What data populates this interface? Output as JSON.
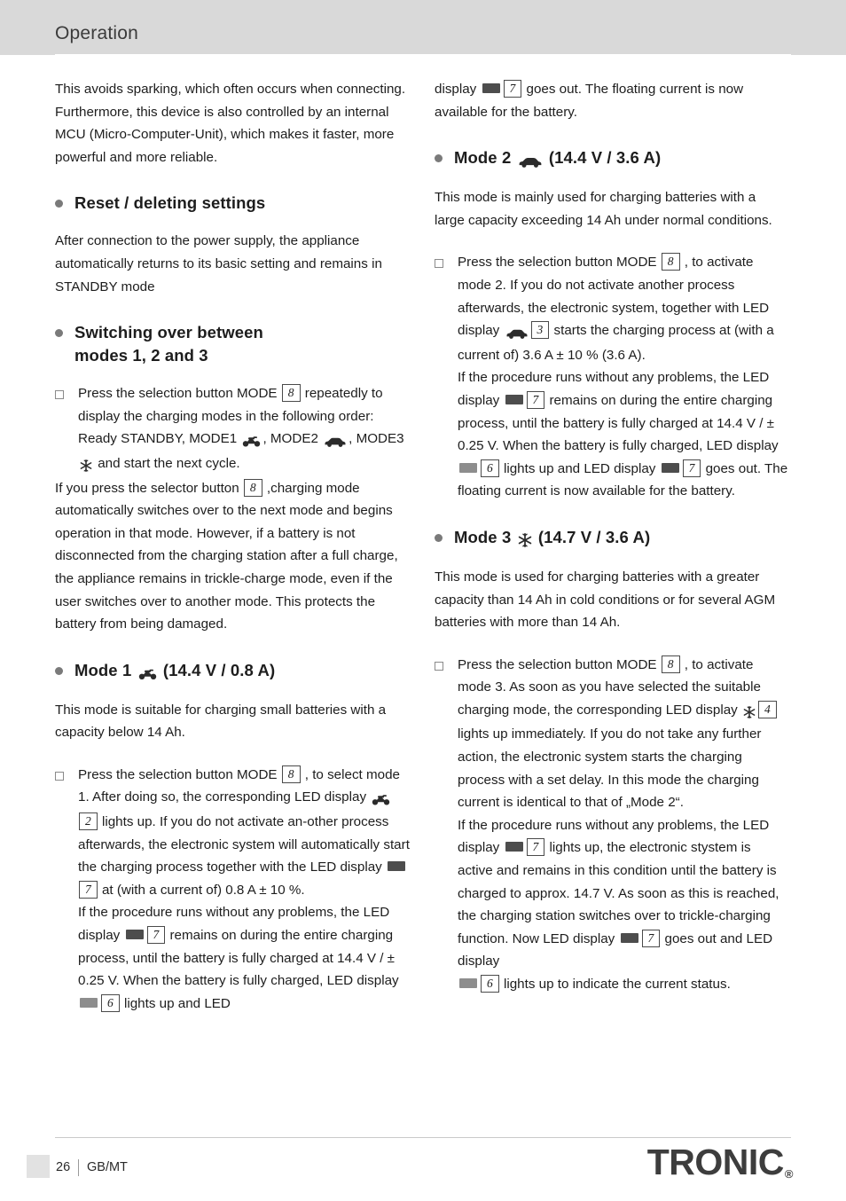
{
  "header": {
    "title": "Operation"
  },
  "left": {
    "intro": "This avoids sparking, which often occurs when connecting. Furthermore, this device is also controlled by an internal MCU (Micro-Computer-Unit), which makes it faster, more powerful and more reliable.",
    "reset_heading": "Reset / deleting settings",
    "reset_text": "After connection to the power supply, the appliance automatically returns to its basic setting and remains in STANDBY mode",
    "switch_heading_l1": "Switching over between",
    "switch_heading_l2": "modes 1, 2 and 3",
    "switch_item_a": "Press the selection button MODE",
    "switch_item_key": "8",
    "switch_item_b": "repeatedly to display the charging modes in the following order: Ready STANDBY, MODE1",
    "switch_item_c": ", MODE2",
    "switch_item_d": ", MODE3",
    "switch_item_e": "and start the next cycle.",
    "switch_para_a": "If you press the selector button",
    "switch_para_key": "8",
    "switch_para_b": ",charging mode automatically switches over to the next mode and begins operation in that mode. However, if a battery is not disconnected from the charging station after a full charge, the appliance remains in trickle-charge mode, even if the user switches over to another mode. This protects the battery from being damaged.",
    "mode1_heading_pre": "Mode 1",
    "mode1_heading_post": "(14.4 V / 0.8 A)",
    "mode1_text": "This mode is suitable for charging small batteries with a capacity below 14 Ah.",
    "mode1_item_a": "Press the selection button MODE",
    "mode1_item_key": "8",
    "mode1_item_b": ", to select mode 1. After doing so, the corresponding LED display",
    "mode1_item_key2": "2",
    "mode1_item_c": "lights up. If you do not activate an-other process afterwards, the electronic system will automatically start the charging process together with the LED display",
    "mode1_item_key3": "7",
    "mode1_item_d": "at (with a current of) 0.8 A ± 10 %.",
    "mode1_item_e": "If the procedure runs without any problems, the LED display",
    "mode1_item_key4": "7",
    "mode1_item_f": "remains on during the entire charging process, until the battery is fully charged at 14.4 V / ± 0.25 V. When the battery is fully charged, LED display",
    "mode1_item_key5": "6",
    "mode1_item_g": "lights up and LED"
  },
  "right": {
    "cont_a": "display",
    "cont_key": "7",
    "cont_b": "goes out. The floating current is now available for the battery.",
    "mode2_heading_pre": "Mode 2",
    "mode2_heading_post": "(14.4 V / 3.6 A)",
    "mode2_text": "This mode is mainly used for charging batteries with a large capacity exceeding 14 Ah under normal conditions.",
    "mode2_item_a": "Press the selection button MODE",
    "mode2_item_key": "8",
    "mode2_item_b": ", to activate mode 2. If you do not activate another process afterwards, the electronic system, together with LED display",
    "mode2_item_key2": "3",
    "mode2_item_c": "starts the charging process at (with a current of) 3.6 A ± 10 % (3.6 A).",
    "mode2_item_d": "If the procedure runs without any problems, the LED display",
    "mode2_item_key3": "7",
    "mode2_item_e": "remains on during the entire charging process, until the battery is fully charged at 14.4 V / ± 0.25 V. When the battery is fully charged, LED display",
    "mode2_item_key4": "6",
    "mode2_item_f": "lights up and LED display",
    "mode2_item_key5": "7",
    "mode2_item_g": "goes out. The floating current is now available for the battery.",
    "mode3_heading_pre": "Mode 3",
    "mode3_heading_post": "(14.7 V / 3.6 A)",
    "mode3_text": "This mode is used for charging batteries with a greater capacity than 14 Ah in cold conditions or for several AGM batteries with more than 14 Ah.",
    "mode3_item_a": "Press the selection button MODE",
    "mode3_item_key": "8",
    "mode3_item_b": ", to activate mode 3. As soon as you have selected the suitable charging mode, the corresponding LED display",
    "mode3_item_key2": "4",
    "mode3_item_c": "lights up immediately. If you do not take any further action, the electronic system starts the charging process with a set delay. In this mode the charging current is identical to that of „Mode 2“.",
    "mode3_item_d": "If the procedure runs without any problems, the LED display",
    "mode3_item_key3": "7",
    "mode3_item_e": "lights up, the electronic stystem is active and remains in this condition until the battery is charged to approx. 14.7 V. As soon as this is reached, the charging station switches over to trickle-charging function. Now LED display",
    "mode3_item_key4": "7",
    "mode3_item_f": "goes out and LED display",
    "mode3_item_key5": "6",
    "mode3_item_g": "lights up to indicate the current status."
  },
  "footer": {
    "page_number": "26",
    "language": "GB/MT",
    "brand": "TRONIC",
    "brand_mark": "®"
  }
}
